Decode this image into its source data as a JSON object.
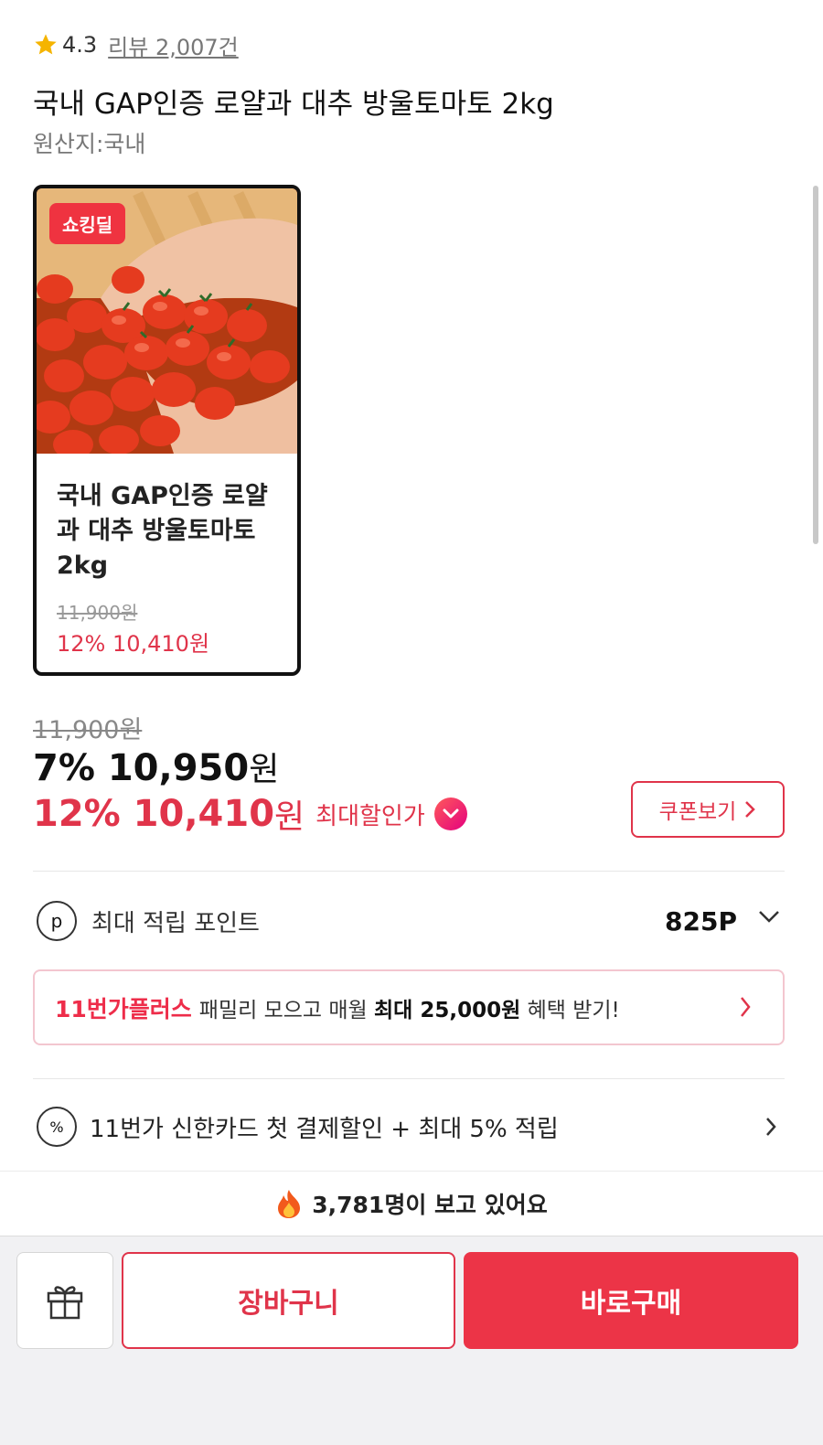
{
  "rating": {
    "value": "4.3",
    "review_link": "리뷰 2,007건"
  },
  "product": {
    "title": "국내 GAP인증 로얄과 대추 방울토마토 2kg",
    "origin": "원산지:국내"
  },
  "deal_card": {
    "badge": "쇼킹딜",
    "name": "국내 GAP인증 로얄과 대추 방울토마토 2kg",
    "original_price": "11,900원",
    "sale_price": "12% 10,410원"
  },
  "price": {
    "original": "11,900원",
    "discount_main": "7% 10,950",
    "won": "원",
    "max_discount": "12% 10,410",
    "max_won": "원",
    "max_label": "최대할인가",
    "coupon_button": "쿠폰보기"
  },
  "points": {
    "label": "최대 적립 포인트",
    "value": "825P",
    "icon_letter": "p"
  },
  "plus_banner": {
    "brand": "11번가플러스",
    "text_before": "패밀리 모으고 매월",
    "bold": "최대 25,000원",
    "text_after": "혜택 받기!"
  },
  "card_promo": {
    "icon_text": "%",
    "text": "11번가 신한카드 첫 결제할인 + 최대 5% 적립"
  },
  "viewers": {
    "text": "3,781명이 보고 있어요"
  },
  "actions": {
    "cart": "장바구니",
    "buy": "바로구매"
  },
  "colors": {
    "accent_red": "#e0344a",
    "buy_button": "#ec3447",
    "star": "#f5b400"
  },
  "icons": [
    "star-icon",
    "check-icon",
    "point-icon",
    "chevron-down-icon",
    "chevron-right-icon",
    "percent-icon",
    "fire-icon",
    "gift-icon"
  ]
}
